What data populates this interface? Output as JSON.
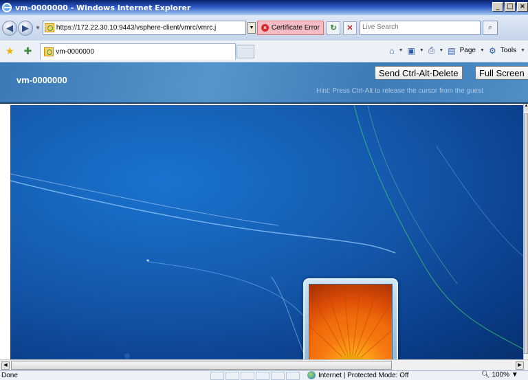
{
  "window": {
    "title": "vm-0000000 - Windows Internet Explorer",
    "controls": [
      "_",
      "□",
      "×"
    ]
  },
  "addressbar": {
    "url": "https://172.22.30.10:9443/vsphere-client/vmrc/vmrc.j",
    "certificate_error": "Certificate Error",
    "search_placeholder": "Live Search"
  },
  "tabs": {
    "active_tab": "vm-0000000"
  },
  "commandbar": {
    "page_label": "Page",
    "tools_label": "Tools"
  },
  "vmrc": {
    "vm_name": "vm-0000000",
    "send_cad_label": "Send Ctrl-Alt-Delete",
    "full_screen_label": "Full Screen",
    "hint": "Hint: Press Ctrl-Alt to release the cursor from the guest"
  },
  "statusbar": {
    "status": "Done",
    "zone": "Internet | Protected Mode: Off",
    "zoom": "100%"
  },
  "colors": {
    "vmrc_header": "#4a88c2",
    "desktop_blue": "#1459ad",
    "cert_error_bg": "#f6bcc4"
  }
}
